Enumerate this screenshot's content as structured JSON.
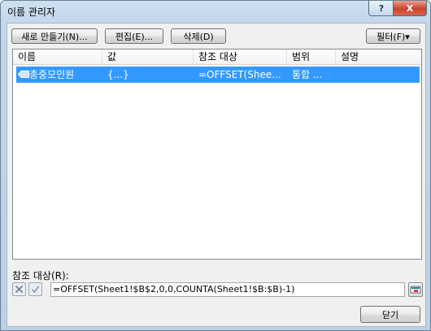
{
  "window": {
    "title": "이름 관리자",
    "help_label": "?",
    "close_label": "X"
  },
  "toolbar": {
    "new_label": "새로 만들기(N)...",
    "edit_label": "편집(E)...",
    "delete_label": "삭제(D)",
    "filter_label": "필터(F)▾"
  },
  "list": {
    "headers": [
      "이름",
      "값",
      "참조 대상",
      "범위",
      "설명"
    ],
    "rows": [
      {
        "name": "총중모인원",
        "value": "{...}",
        "refers_to": "=OFFSET(Shee...",
        "scope": "통합 ...",
        "comment": ""
      }
    ]
  },
  "refers_to": {
    "label": "참조 대상(R):",
    "value": "=OFFSET(Sheet1!$B$2,0,0,COUNTA(Sheet1!$B:$B)-1)"
  },
  "footer": {
    "close_label": "닫기"
  },
  "colors": {
    "selection": "#3399ff"
  }
}
